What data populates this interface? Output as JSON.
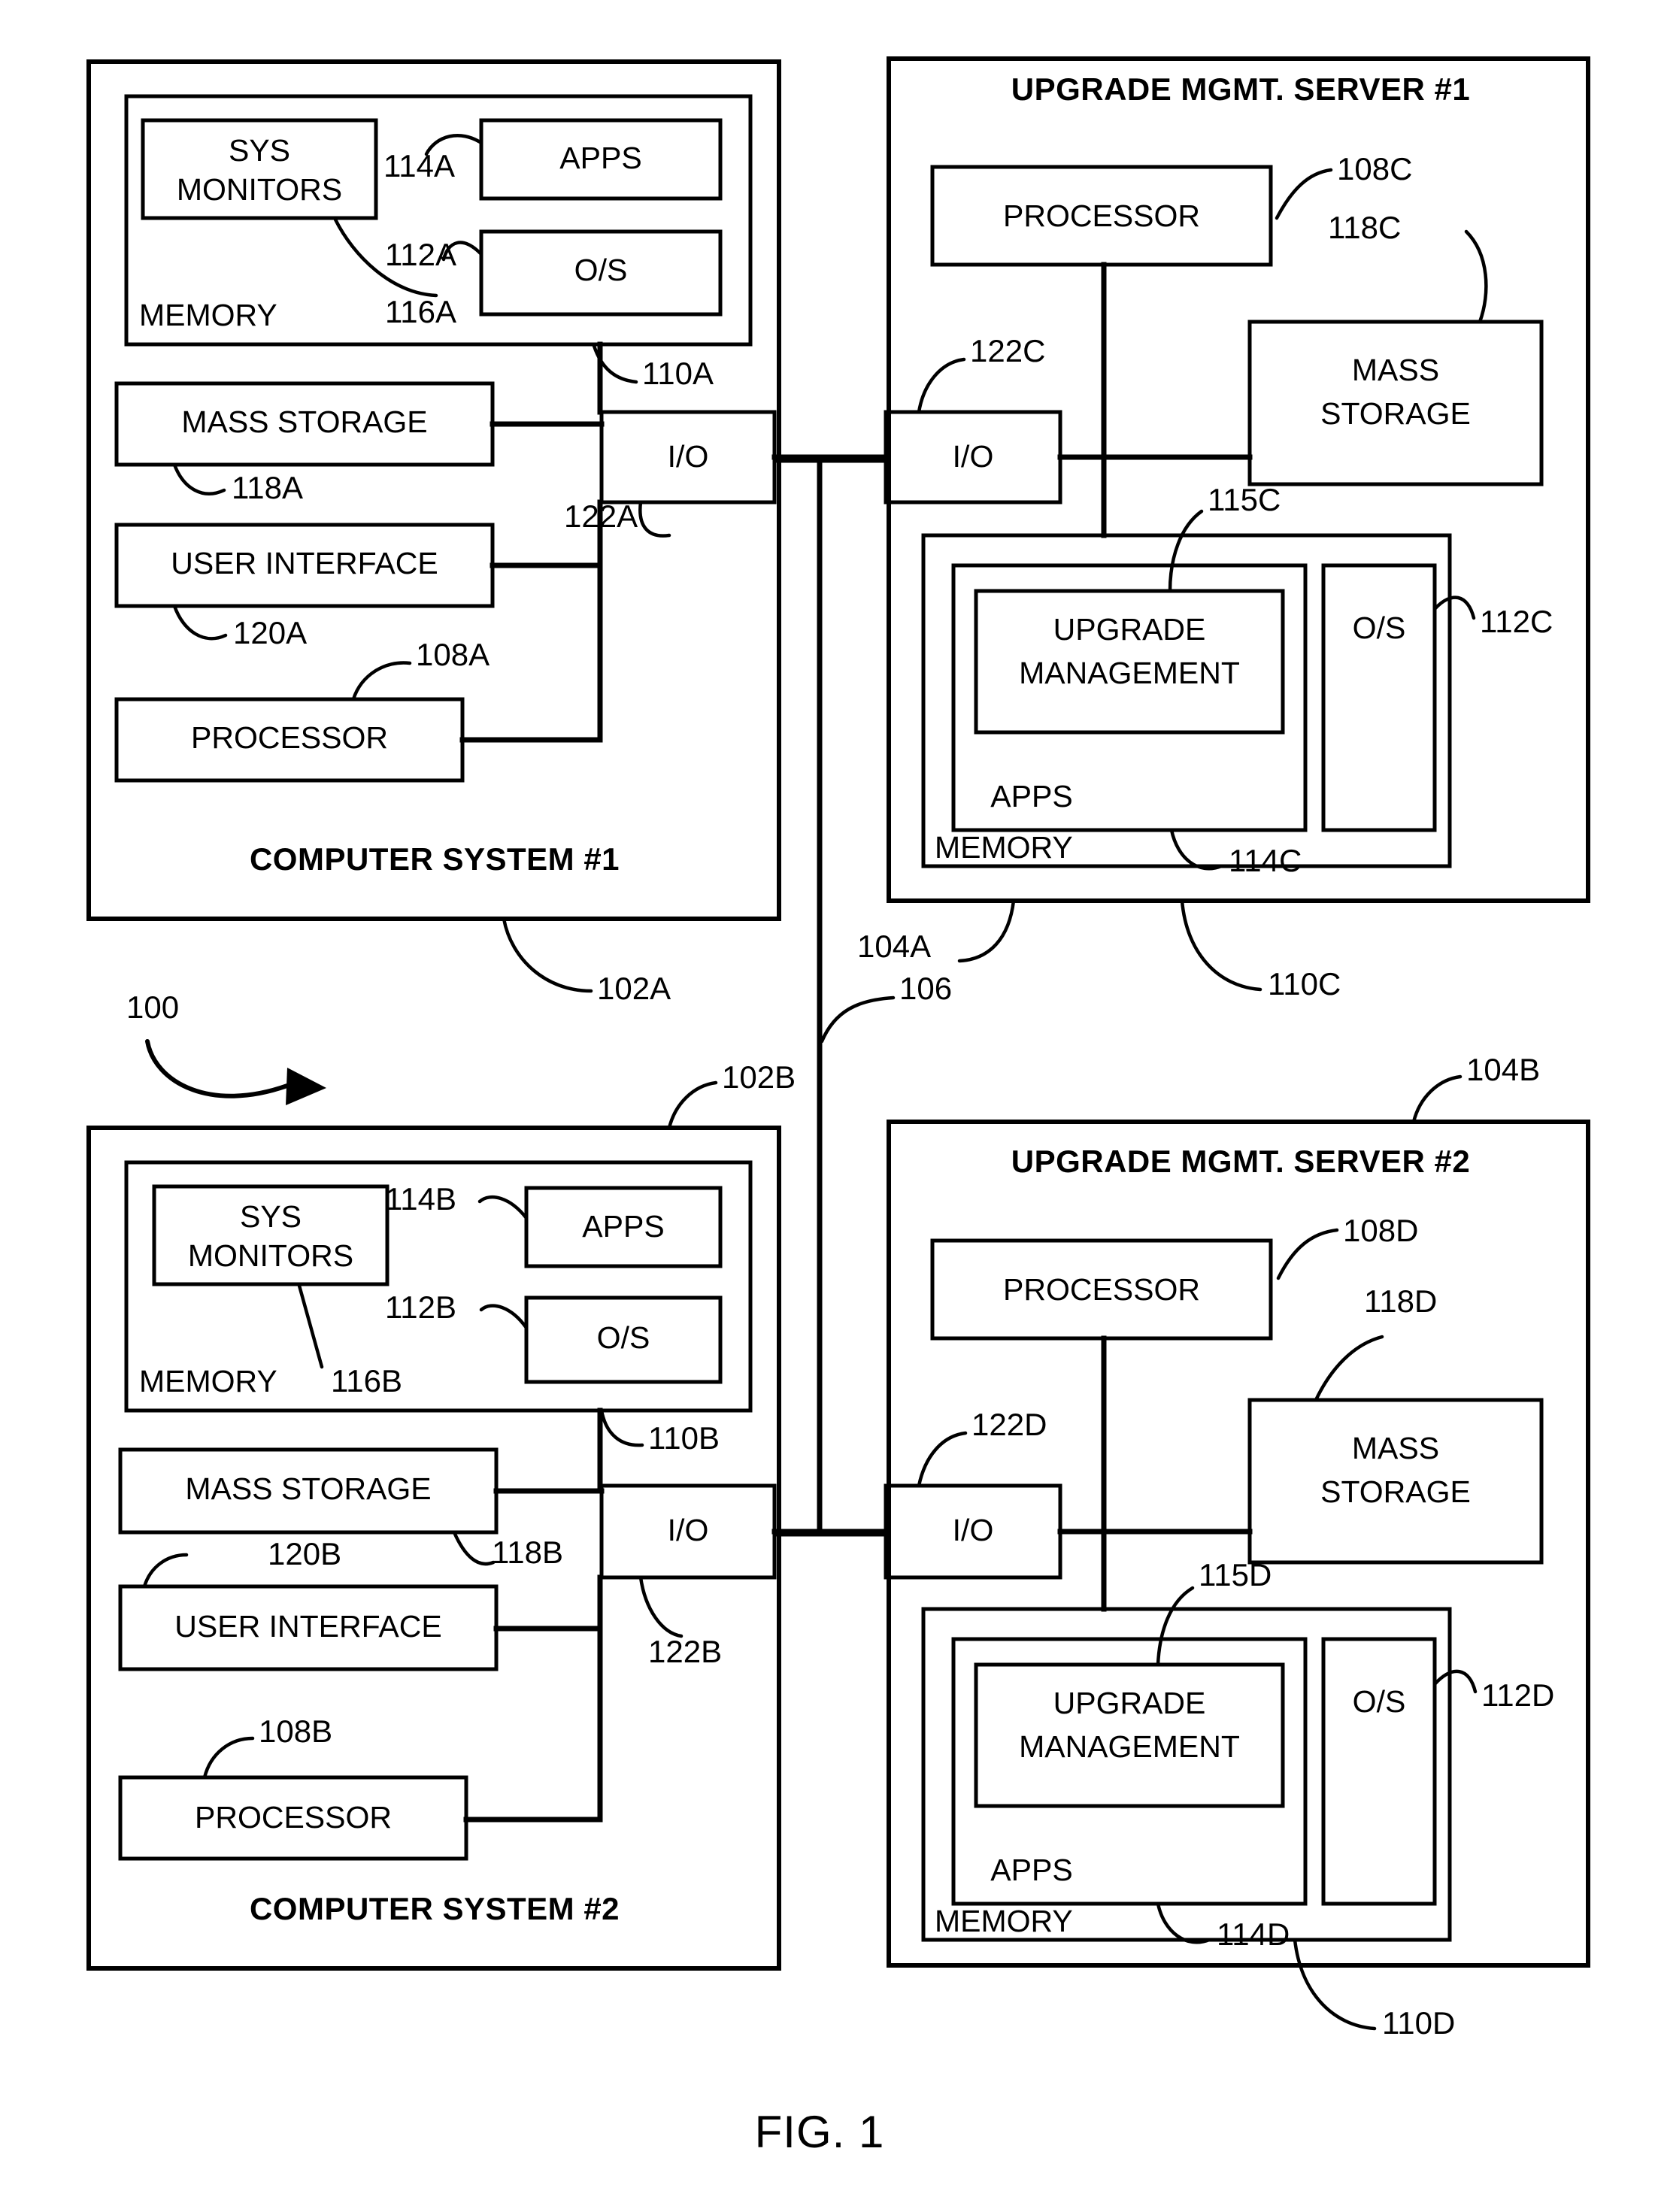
{
  "figure": {
    "caption": "FIG. 1",
    "system_ref": "100"
  },
  "computer_system_1": {
    "title": "COMPUTER SYSTEM #1",
    "ref": "102A",
    "memory": {
      "label": "MEMORY",
      "ref": "110A",
      "sys_monitors": {
        "line1": "SYS",
        "line2": "MONITORS",
        "ref": "116A"
      },
      "apps": {
        "label": "APPS",
        "ref": "114A"
      },
      "os": {
        "label": "O/S",
        "ref": "112A"
      }
    },
    "mass_storage": {
      "label": "MASS STORAGE",
      "ref": "118A"
    },
    "user_interface": {
      "label": "USER INTERFACE",
      "ref": "120A"
    },
    "processor": {
      "label": "PROCESSOR",
      "ref": "108A"
    },
    "io": {
      "label": "I/O",
      "ref": "122A"
    }
  },
  "computer_system_2": {
    "title": "COMPUTER SYSTEM #2",
    "ref": "102B",
    "memory": {
      "label": "MEMORY",
      "ref": "110B",
      "sys_monitors": {
        "line1": "SYS",
        "line2": "MONITORS",
        "ref": "116B"
      },
      "apps": {
        "label": "APPS",
        "ref": "114B"
      },
      "os": {
        "label": "O/S",
        "ref": "112B"
      }
    },
    "mass_storage": {
      "label": "MASS STORAGE",
      "ref": "118B"
    },
    "user_interface": {
      "label": "USER INTERFACE",
      "ref": "120B"
    },
    "processor": {
      "label": "PROCESSOR",
      "ref": "108B"
    },
    "io": {
      "label": "I/O",
      "ref": "122B"
    }
  },
  "server_1": {
    "title": "UPGRADE MGMT. SERVER #1",
    "ref": "104A",
    "processor": {
      "label": "PROCESSOR",
      "ref": "108C"
    },
    "mass_storage": {
      "line1": "MASS",
      "line2": "STORAGE",
      "ref": "118C"
    },
    "io": {
      "label": "I/O",
      "ref": "122C"
    },
    "memory": {
      "label": "MEMORY",
      "ref": "110C",
      "apps": {
        "label": "APPS",
        "ref": "114C"
      },
      "upgrade_management": {
        "line1": "UPGRADE",
        "line2": "MANAGEMENT",
        "ref": "115C"
      },
      "os": {
        "label": "O/S",
        "ref": "112C"
      }
    }
  },
  "server_2": {
    "title": "UPGRADE MGMT. SERVER #2",
    "ref": "104B",
    "processor": {
      "label": "PROCESSOR",
      "ref": "108D"
    },
    "mass_storage": {
      "line1": "MASS",
      "line2": "STORAGE",
      "ref": "118D"
    },
    "io": {
      "label": "I/O",
      "ref": "122D"
    },
    "memory": {
      "label": "MEMORY",
      "ref": "110D",
      "apps": {
        "label": "APPS",
        "ref": "114D"
      },
      "upgrade_management": {
        "line1": "UPGRADE",
        "line2": "MANAGEMENT",
        "ref": "115D"
      },
      "os": {
        "label": "O/S",
        "ref": "112D"
      }
    }
  },
  "network": {
    "ref": "106"
  },
  "colors": {
    "ink": "#000000",
    "paper": "#ffffff"
  }
}
